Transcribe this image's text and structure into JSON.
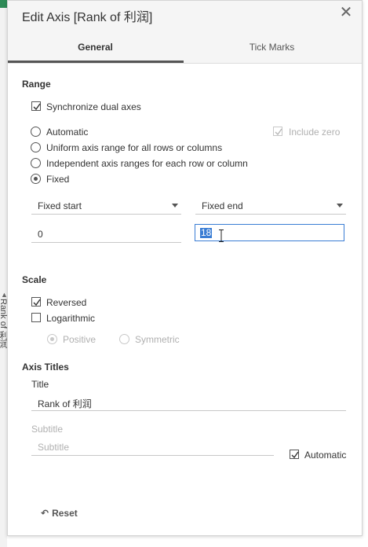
{
  "backdrop": {
    "vertical_label": "Rank of 利润"
  },
  "dialog": {
    "title": "Edit Axis [Rank of 利润]",
    "close_icon": "close-icon",
    "tabs": [
      {
        "label": "General",
        "active": true
      },
      {
        "label": "Tick Marks",
        "active": false
      }
    ]
  },
  "range": {
    "heading": "Range",
    "synchronize_label": "Synchronize dual axes",
    "synchronize_checked": true,
    "options": [
      {
        "label": "Automatic",
        "selected": false
      },
      {
        "label": "Uniform axis range for all rows or columns",
        "selected": false
      },
      {
        "label": "Independent axis ranges for each row or column",
        "selected": false
      },
      {
        "label": "Fixed",
        "selected": true
      }
    ],
    "include_zero_label": "Include zero",
    "include_zero_checked": true,
    "fixed_start_label": "Fixed start",
    "fixed_end_label": "Fixed end",
    "fixed_start_value": "0",
    "fixed_end_value": "18"
  },
  "scale": {
    "heading": "Scale",
    "reversed_label": "Reversed",
    "reversed_checked": true,
    "log_label": "Logarithmic",
    "log_checked": false,
    "positive_label": "Positive",
    "symmetric_label": "Symmetric"
  },
  "axis_titles": {
    "heading": "Axis Titles",
    "title_label": "Title",
    "title_value": "Rank of 利润",
    "subtitle_label": "Subtitle",
    "subtitle_placeholder": "Subtitle",
    "automatic_label": "Automatic",
    "automatic_checked": true
  },
  "footer": {
    "reset_label": "Reset",
    "reset_icon": "undo-icon"
  },
  "colors": {
    "accent": "#3a7dd4",
    "tab_underline": "#555555",
    "disabled": "#b0b0b0"
  }
}
